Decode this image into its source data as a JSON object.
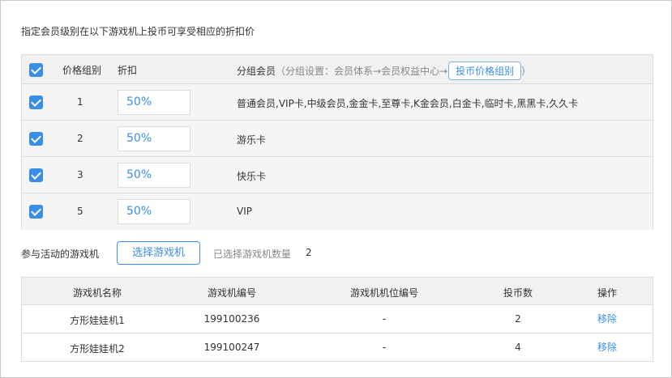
{
  "intro": "指定会员级别在以下游戏机上投币可享受相应的折扣价",
  "group_table": {
    "headers": {
      "group": "价格组别",
      "discount": "折扣",
      "members": "分组会员",
      "hint": "（分组设置：会员体系→会员权益中心→",
      "hint_close": "）",
      "link_button": "投币价格组别"
    },
    "rows": [
      {
        "group": "1",
        "discount": "50%",
        "members": "普通会员,VIP卡,中级会员,金金卡,至尊卡,K金会员,白金卡,临时卡,黑黑卡,久久卡"
      },
      {
        "group": "2",
        "discount": "50%",
        "members": "游乐卡"
      },
      {
        "group": "3",
        "discount": "50%",
        "members": "快乐卡"
      },
      {
        "group": "5",
        "discount": "50%",
        "members": "VIP"
      }
    ]
  },
  "participation": {
    "label": "参与活动的游戏机",
    "choose_button": "选择游戏机",
    "selected_label": "已选择游戏机数量",
    "selected_count": "2"
  },
  "machine_table": {
    "headers": {
      "name": "游戏机名称",
      "code": "游戏机编号",
      "slot": "游戏机机位编号",
      "coins": "投币数",
      "action": "操作"
    },
    "rows": [
      {
        "name": "方形娃娃机1",
        "code": "199100236",
        "slot": "-",
        "coins": "2",
        "action": "移除"
      },
      {
        "name": "方形娃娃机2",
        "code": "199100247",
        "slot": "-",
        "coins": "4",
        "action": "移除"
      }
    ]
  },
  "colors": {
    "accent": "#3a8ee6",
    "border": "#dcdcdc",
    "header_bg": "#f1f1f1"
  }
}
